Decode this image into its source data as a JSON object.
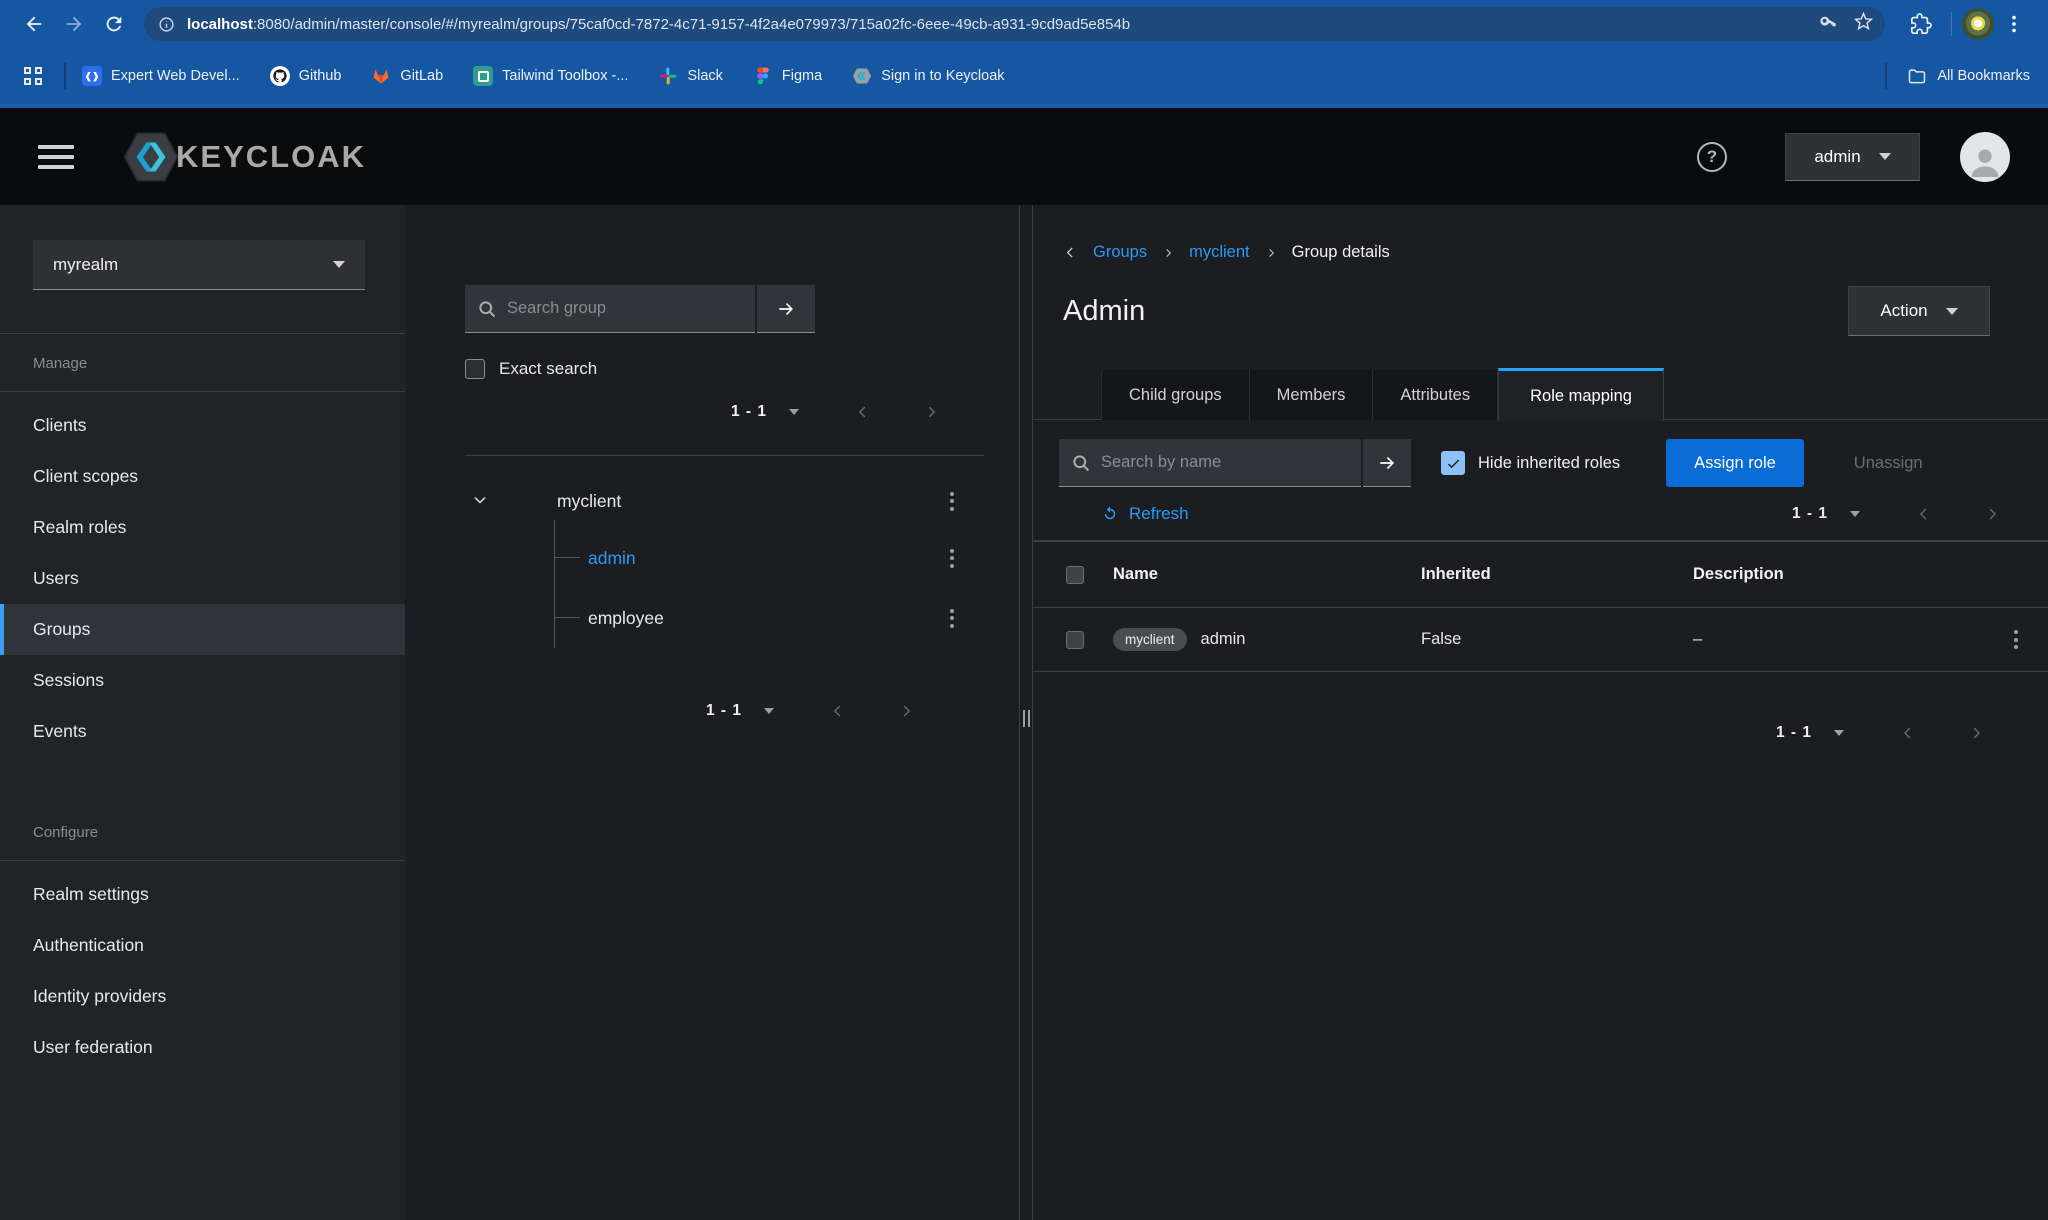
{
  "chrome": {
    "url_host": "localhost",
    "url_rest": ":8080/admin/master/console/#/myrealm/groups/75caf0cd-7872-4c71-9157-4f2a4e079973/715a02fc-6eee-49cb-a931-9cd9ad5e854b",
    "bookmarks": [
      "Expert Web Devel...",
      "Github",
      "GitLab",
      "Tailwind Toolbox -...",
      "Slack",
      "Figma",
      "Sign in to Keycloak"
    ],
    "all_bookmarks": "All Bookmarks"
  },
  "masthead": {
    "brand": "KEYCLOAK",
    "username": "admin"
  },
  "sidebar": {
    "realm": "myrealm",
    "manage_label": "Manage",
    "manage_items": [
      "Clients",
      "Client scopes",
      "Realm roles",
      "Users",
      "Groups",
      "Sessions",
      "Events"
    ],
    "configure_label": "Configure",
    "configure_items": [
      "Realm settings",
      "Authentication",
      "Identity providers",
      "User federation"
    ]
  },
  "groups": {
    "search_placeholder": "Search group",
    "exact_search_label": "Exact search",
    "pagination_top": "1 - 1",
    "root": "myclient",
    "children": [
      "admin",
      "employee"
    ],
    "pagination_bottom": "1 - 1"
  },
  "details": {
    "breadcrumb": {
      "groups": "Groups",
      "client": "myclient",
      "current": "Group details"
    },
    "title": "Admin",
    "action_label": "Action",
    "tabs": [
      "Child groups",
      "Members",
      "Attributes",
      "Role mapping"
    ],
    "search_placeholder": "Search by name",
    "hide_inherited_label": "Hide inherited roles",
    "assign_label": "Assign role",
    "unassign_label": "Unassign",
    "refresh_label": "Refresh",
    "pagination_mid": "1 - 1",
    "columns": {
      "name": "Name",
      "inherited": "Inherited",
      "description": "Description"
    },
    "row": {
      "badge": "myclient",
      "name": "admin",
      "inherited": "False",
      "description": "–"
    },
    "pagination_bottom": "1 - 1"
  },
  "colors": {
    "accent_blue": "#2b9af3",
    "primary_button": "#0a6cd6",
    "chrome_bar": "#1557a3",
    "active_tab_border": "#1fa7f8",
    "selected_nav_border": "#3b9df5"
  }
}
